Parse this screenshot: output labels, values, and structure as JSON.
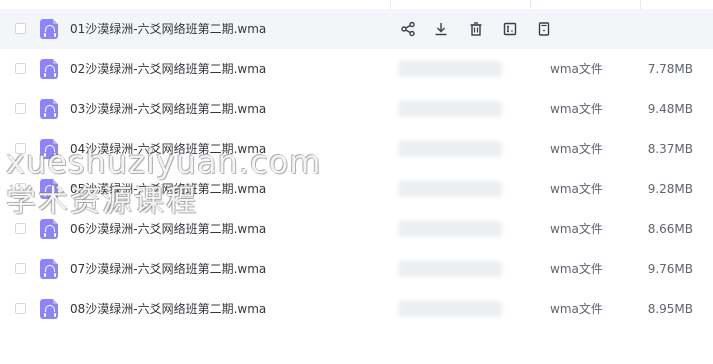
{
  "files": [
    {
      "name": "01沙漠绿洲-六爻网络班第二期.wma",
      "type": "",
      "size": ""
    },
    {
      "name": "02沙漠绿洲-六爻网络班第二期.wma",
      "type": "wma文件",
      "size": "7.78MB"
    },
    {
      "name": "03沙漠绿洲-六爻网络班第二期.wma",
      "type": "wma文件",
      "size": "9.48MB"
    },
    {
      "name": "04沙漠绿洲-六爻网络班第二期.wma",
      "type": "wma文件",
      "size": "8.37MB"
    },
    {
      "name": "05沙漠绿洲-六爻网络班第二期.wma",
      "type": "wma文件",
      "size": "9.28MB"
    },
    {
      "name": "06沙漠绿洲-六爻网络班第二期.wma",
      "type": "wma文件",
      "size": "8.66MB"
    },
    {
      "name": "07沙漠绿洲-六爻网络班第二期.wma",
      "type": "wma文件",
      "size": "9.76MB"
    },
    {
      "name": "08沙漠绿洲-六爻网络班第二期.wma",
      "type": "wma文件",
      "size": "8.95MB"
    }
  ],
  "row_actions": [
    "share-icon",
    "download-icon",
    "delete-icon",
    "rename-icon",
    "more-icon"
  ],
  "watermark": {
    "line1": "xueshuziyuan.com",
    "line2": "学术资源课程"
  },
  "colors": {
    "hover_row": "#f4f5f9",
    "file_icon": "#8d85f6",
    "text": "#33373d"
  }
}
